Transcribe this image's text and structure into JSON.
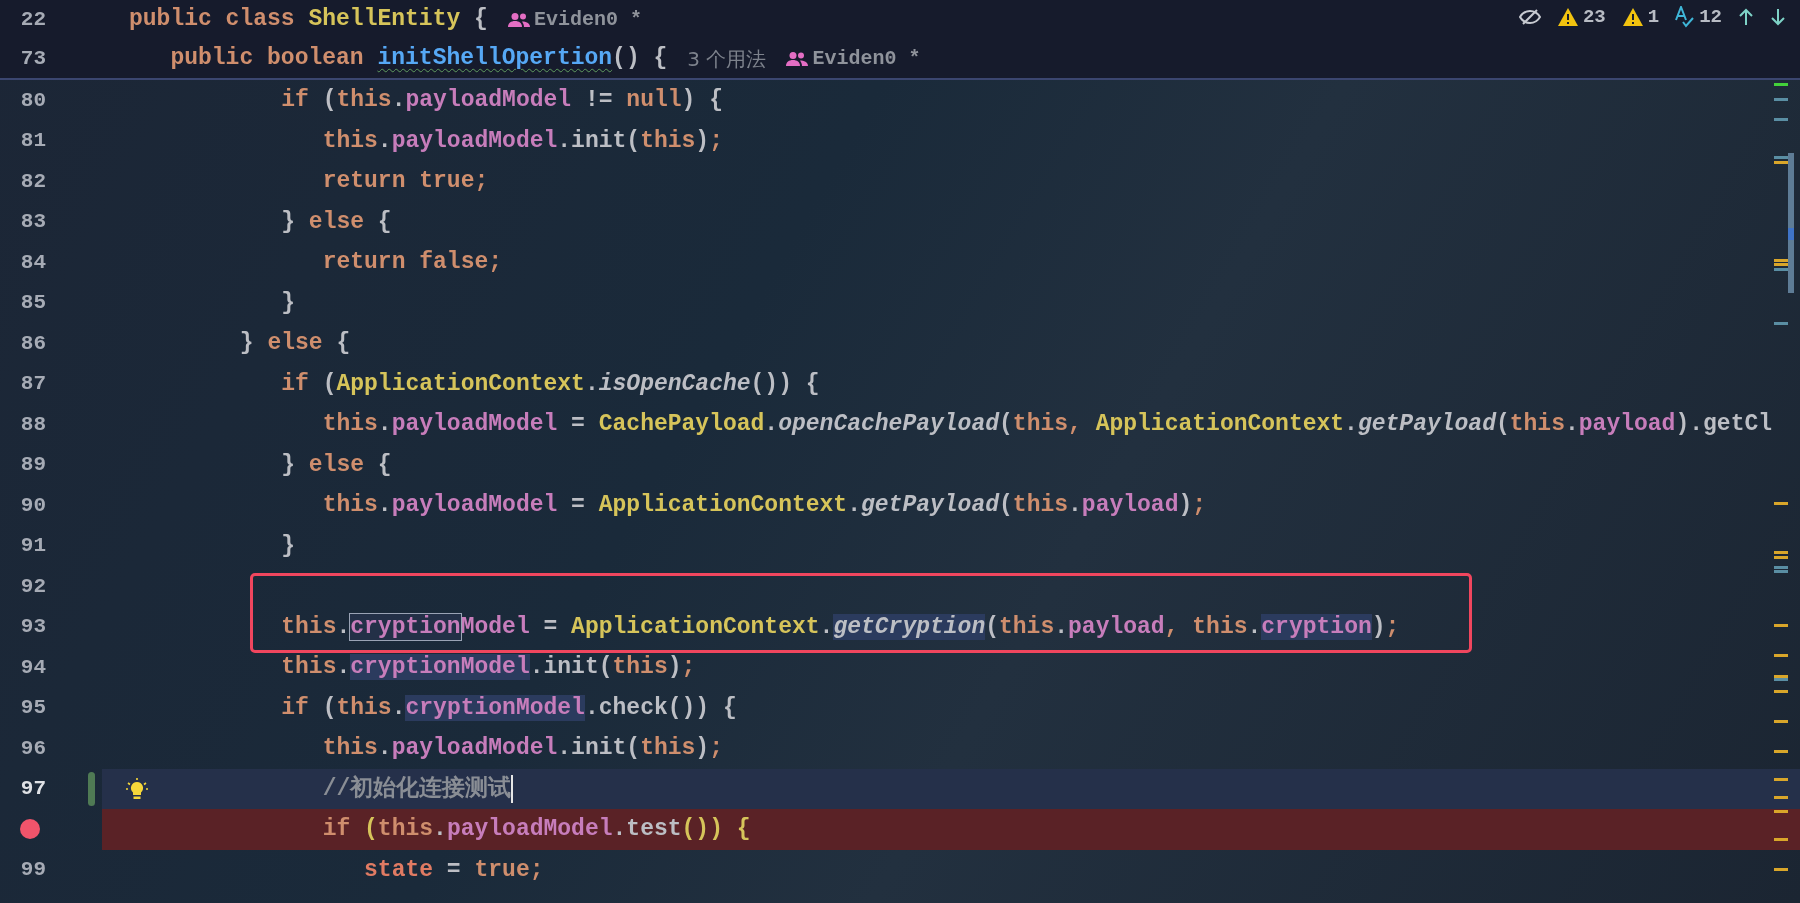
{
  "toolbar": {
    "warnings": "23",
    "weak_warnings": "1",
    "typos": "12"
  },
  "sticky_lines": [
    {
      "number": "22",
      "tokens": [
        {
          "kind": "k",
          "text": "public class "
        },
        {
          "kind": "t",
          "text": "ShellEntity"
        },
        {
          "kind": "p",
          "text": " {"
        }
      ],
      "author": "Eviden0 *"
    },
    {
      "number": "73",
      "tokens": [
        {
          "kind": "k",
          "text": "   public boolean "
        },
        {
          "kind": "m",
          "text": "initShellOpertion"
        },
        {
          "kind": "p",
          "text": "() {"
        }
      ],
      "usages": "3 个用法",
      "author": "Eviden0 *"
    }
  ],
  "code_lines": [
    {
      "kind": "code",
      "number": "80",
      "boxed": false,
      "tokens": [
        {
          "kind": "k",
          "text": "         if "
        },
        {
          "kind": "p",
          "text": "("
        },
        {
          "kind": "k",
          "text": "this"
        },
        {
          "kind": "p",
          "text": "."
        },
        {
          "kind": "f",
          "text": "payloadModel"
        },
        {
          "kind": "p",
          "text": " != "
        },
        {
          "kind": "k",
          "text": "null"
        },
        {
          "kind": "p",
          "text": ") {"
        }
      ]
    },
    {
      "kind": "code",
      "number": "81",
      "boxed": false,
      "tokens": [
        {
          "kind": "k",
          "text": "            this"
        },
        {
          "kind": "p",
          "text": "."
        },
        {
          "kind": "f",
          "text": "payloadModel"
        },
        {
          "kind": "p",
          "text": ".init("
        },
        {
          "kind": "k",
          "text": "this"
        },
        {
          "kind": "p",
          "text": ")"
        },
        {
          "kind": "k",
          "text": ";"
        }
      ]
    },
    {
      "kind": "code",
      "number": "82",
      "boxed": false,
      "tokens": [
        {
          "kind": "k",
          "text": "            return true;"
        }
      ]
    },
    {
      "kind": "code",
      "number": "83",
      "boxed": false,
      "tokens": [
        {
          "kind": "p",
          "text": "         } "
        },
        {
          "kind": "k",
          "text": "else "
        },
        {
          "kind": "p",
          "text": "{"
        }
      ]
    },
    {
      "kind": "code",
      "number": "84",
      "boxed": false,
      "tokens": [
        {
          "kind": "k",
          "text": "            return false;"
        }
      ]
    },
    {
      "kind": "code",
      "number": "85",
      "boxed": false,
      "tokens": [
        {
          "kind": "p",
          "text": "         }"
        }
      ]
    },
    {
      "kind": "code",
      "number": "86",
      "boxed": false,
      "tokens": [
        {
          "kind": "p",
          "text": "      } "
        },
        {
          "kind": "k",
          "text": "else "
        },
        {
          "kind": "p",
          "text": "{"
        }
      ]
    },
    {
      "kind": "code",
      "number": "87",
      "boxed": false,
      "tokens": [
        {
          "kind": "k",
          "text": "         if "
        },
        {
          "kind": "p",
          "text": "("
        },
        {
          "kind": "t",
          "text": "ApplicationContext"
        },
        {
          "kind": "p",
          "text": "."
        },
        {
          "kind": "s",
          "text": "isOpenCache"
        },
        {
          "kind": "p",
          "text": "()) {"
        }
      ]
    },
    {
      "kind": "code",
      "number": "88",
      "boxed": false,
      "tokens": [
        {
          "kind": "k",
          "text": "            this"
        },
        {
          "kind": "p",
          "text": "."
        },
        {
          "kind": "f",
          "text": "payloadModel"
        },
        {
          "kind": "p",
          "text": " = "
        },
        {
          "kind": "t",
          "text": "CachePayload"
        },
        {
          "kind": "p",
          "text": "."
        },
        {
          "kind": "s",
          "text": "openCachePayload"
        },
        {
          "kind": "p",
          "text": "("
        },
        {
          "kind": "k",
          "text": "this, "
        },
        {
          "kind": "t",
          "text": "ApplicationContext"
        },
        {
          "kind": "p",
          "text": "."
        },
        {
          "kind": "s",
          "text": "getPayload"
        },
        {
          "kind": "p",
          "text": "("
        },
        {
          "kind": "k",
          "text": "this"
        },
        {
          "kind": "p",
          "text": "."
        },
        {
          "kind": "f",
          "text": "payload"
        },
        {
          "kind": "p",
          "text": ").getCl"
        }
      ]
    },
    {
      "kind": "code",
      "number": "89",
      "boxed": false,
      "tokens": [
        {
          "kind": "p",
          "text": "         } "
        },
        {
          "kind": "k",
          "text": "else "
        },
        {
          "kind": "p",
          "text": "{"
        }
      ]
    },
    {
      "kind": "code",
      "number": "90",
      "boxed": false,
      "tokens": [
        {
          "kind": "k",
          "text": "            this"
        },
        {
          "kind": "p",
          "text": "."
        },
        {
          "kind": "f",
          "text": "payloadModel"
        },
        {
          "kind": "p",
          "text": " = "
        },
        {
          "kind": "t",
          "text": "ApplicationContext"
        },
        {
          "kind": "p",
          "text": "."
        },
        {
          "kind": "s",
          "text": "getPayload"
        },
        {
          "kind": "p",
          "text": "("
        },
        {
          "kind": "k",
          "text": "this"
        },
        {
          "kind": "p",
          "text": "."
        },
        {
          "kind": "f",
          "text": "payload"
        },
        {
          "kind": "p",
          "text": ")"
        },
        {
          "kind": "k",
          "text": ";"
        }
      ]
    },
    {
      "kind": "code",
      "number": "91",
      "boxed": false,
      "tokens": [
        {
          "kind": "p",
          "text": "         }"
        }
      ]
    },
    {
      "kind": "code",
      "number": "92",
      "boxed": true
    },
    {
      "kind": "code",
      "number": "93",
      "boxed": true,
      "tokens": [
        {
          "kind": "k",
          "text": "         this"
        },
        {
          "kind": "p",
          "text": "."
        },
        {
          "kind": "f",
          "text": "cryption",
          "selected": true
        },
        {
          "kind": "f",
          "text": "Model"
        },
        {
          "kind": "p",
          "text": " = "
        },
        {
          "kind": "t",
          "text": "ApplicationContext"
        },
        {
          "kind": "p",
          "text": "."
        },
        {
          "kind": "s",
          "text": "getCryption",
          "highlighted": true
        },
        {
          "kind": "p",
          "text": "("
        },
        {
          "kind": "k",
          "text": "this"
        },
        {
          "kind": "p",
          "text": "."
        },
        {
          "kind": "f",
          "text": "payload"
        },
        {
          "kind": "k",
          "text": ", this"
        },
        {
          "kind": "p",
          "text": "."
        },
        {
          "kind": "f",
          "text": "cryption",
          "highlighted": true
        },
        {
          "kind": "p",
          "text": ")"
        },
        {
          "kind": "k",
          "text": ";"
        }
      ]
    },
    {
      "kind": "code",
      "number": "94",
      "boxed": false,
      "tokens": [
        {
          "kind": "k",
          "text": "         this"
        },
        {
          "kind": "p",
          "text": "."
        },
        {
          "kind": "f",
          "text": "cryptionModel",
          "highlighted": true
        },
        {
          "kind": "p",
          "text": ".init("
        },
        {
          "kind": "k",
          "text": "this"
        },
        {
          "kind": "p",
          "text": ")"
        },
        {
          "kind": "k",
          "text": ";"
        }
      ]
    },
    {
      "kind": "code",
      "number": "95",
      "boxed": false,
      "tokens": [
        {
          "kind": "k",
          "text": "         if "
        },
        {
          "kind": "p",
          "text": "("
        },
        {
          "kind": "k",
          "text": "this"
        },
        {
          "kind": "p",
          "text": "."
        },
        {
          "kind": "f",
          "text": "cryptionModel",
          "highlighted": true
        },
        {
          "kind": "p",
          "text": ".check()) {"
        }
      ]
    },
    {
      "kind": "code",
      "number": "96",
      "boxed": false,
      "tokens": [
        {
          "kind": "k",
          "text": "            this"
        },
        {
          "kind": "p",
          "text": "."
        },
        {
          "kind": "f",
          "text": "payloadModel"
        },
        {
          "kind": "p",
          "text": ".init("
        },
        {
          "kind": "k",
          "text": "this"
        },
        {
          "kind": "p",
          "text": ")"
        },
        {
          "kind": "k",
          "text": ";"
        }
      ]
    },
    {
      "kind": "current",
      "number": "97",
      "boxed": false,
      "tokens": [
        {
          "kind": "c",
          "text": "            //初始化连接测试"
        }
      ]
    },
    {
      "kind": "breakpoint",
      "boxed": false,
      "tokens": [
        {
          "kind": "k",
          "text": "            if "
        },
        {
          "kind": "y",
          "text": "("
        },
        {
          "kind": "k",
          "text": "this"
        },
        {
          "kind": "p",
          "text": "."
        },
        {
          "kind": "f",
          "text": "payloadModel"
        },
        {
          "kind": "p",
          "text": ".test"
        },
        {
          "kind": "y",
          "text": "()) {"
        }
      ]
    },
    {
      "kind": "code",
      "number": "99",
      "boxed": false,
      "tokens": [
        {
          "kind": "r",
          "text": "               state"
        },
        {
          "kind": "p",
          "text": " = "
        },
        {
          "kind": "k",
          "text": "true;"
        }
      ]
    }
  ]
}
